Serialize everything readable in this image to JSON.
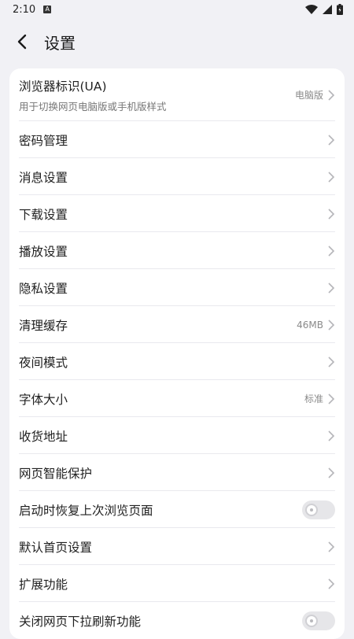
{
  "status_bar": {
    "time": "2:10",
    "notification_badge": "A"
  },
  "header": {
    "title": "设置"
  },
  "settings": {
    "browser_ua": {
      "label": "浏览器标识(UA)",
      "subtitle": "用于切换网页电脑版或手机版样式",
      "value": "电脑版"
    },
    "password": {
      "label": "密码管理"
    },
    "messages": {
      "label": "消息设置"
    },
    "download": {
      "label": "下载设置"
    },
    "playback": {
      "label": "播放设置"
    },
    "privacy": {
      "label": "隐私设置"
    },
    "cache": {
      "label": "清理缓存",
      "value": "46MB"
    },
    "night_mode": {
      "label": "夜间模式"
    },
    "font_size": {
      "label": "字体大小",
      "value": "标准"
    },
    "address": {
      "label": "收货地址"
    },
    "web_protection": {
      "label": "网页智能保护"
    },
    "restore_last": {
      "label": "启动时恢复上次浏览页面",
      "toggle_on": false
    },
    "default_home": {
      "label": "默认首页设置"
    },
    "extensions": {
      "label": "扩展功能"
    },
    "pull_refresh": {
      "label": "关闭网页下拉刷新功能",
      "toggle_on": false
    }
  },
  "icons": {
    "back": "back-arrow-icon",
    "chevron": "chevron-right-icon",
    "wifi": "wifi-icon",
    "signal": "signal-icon",
    "battery": "battery-icon"
  },
  "colors": {
    "page_bg": "#f1f1f5",
    "card_bg": "#ffffff",
    "toggle_off": "#e6e6e9"
  }
}
